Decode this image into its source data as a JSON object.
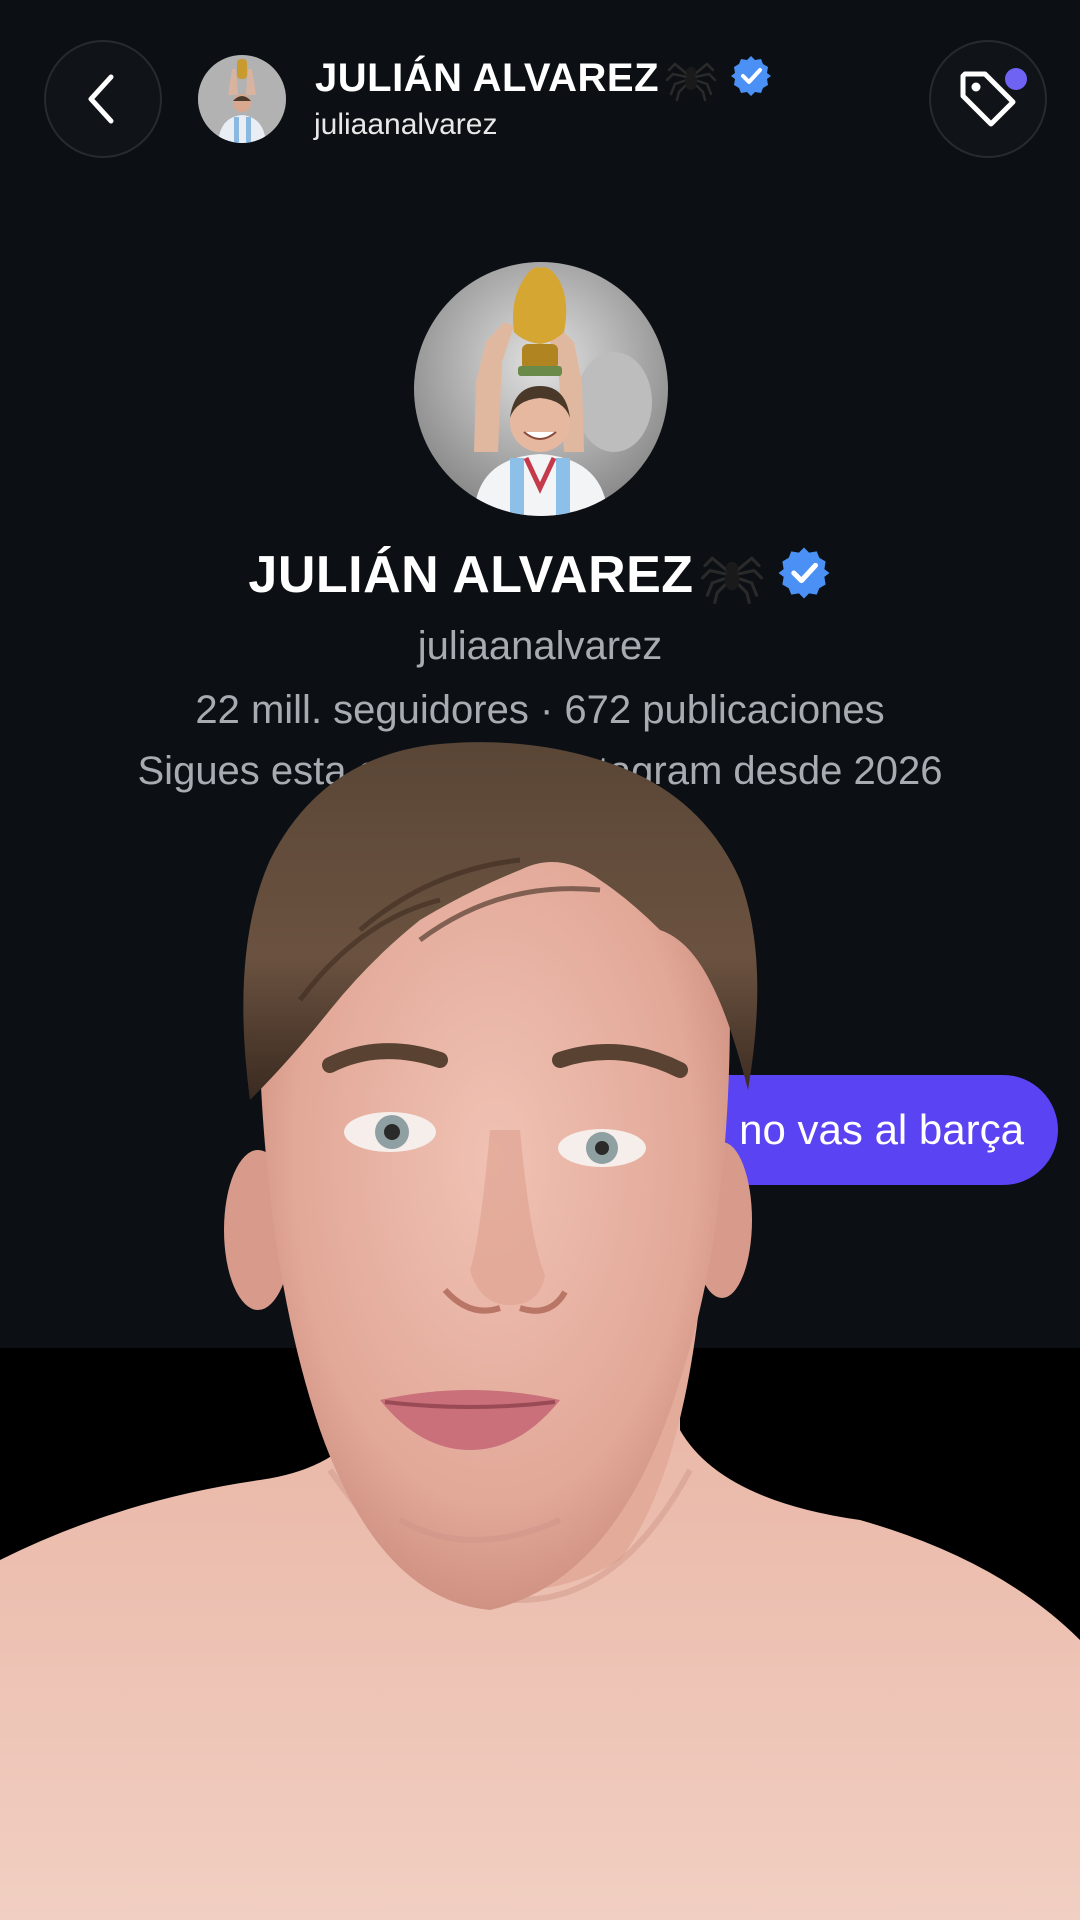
{
  "header": {
    "back_icon": "chevron-left-icon",
    "name": "JULIÁN ALVAREZ",
    "name_emoji": "🕷",
    "verified_icon": "verified-badge-icon",
    "username": "juliaanalvarez",
    "tag_icon": "tag-icon"
  },
  "profile": {
    "name": "JULIÁN ALVAREZ",
    "name_emoji": "🕷",
    "username": "juliaanalvarez",
    "stats": "22 mill. seguidores · 672 publicaciones",
    "since": "Sigues esta cuenta de Instagram desde 2026"
  },
  "message": {
    "text": "no vas al barça"
  },
  "colors": {
    "background": "#0c1014",
    "bubble": "#5a43f2",
    "verified": "#4a90f5",
    "notification_dot": "#6f63f4"
  }
}
